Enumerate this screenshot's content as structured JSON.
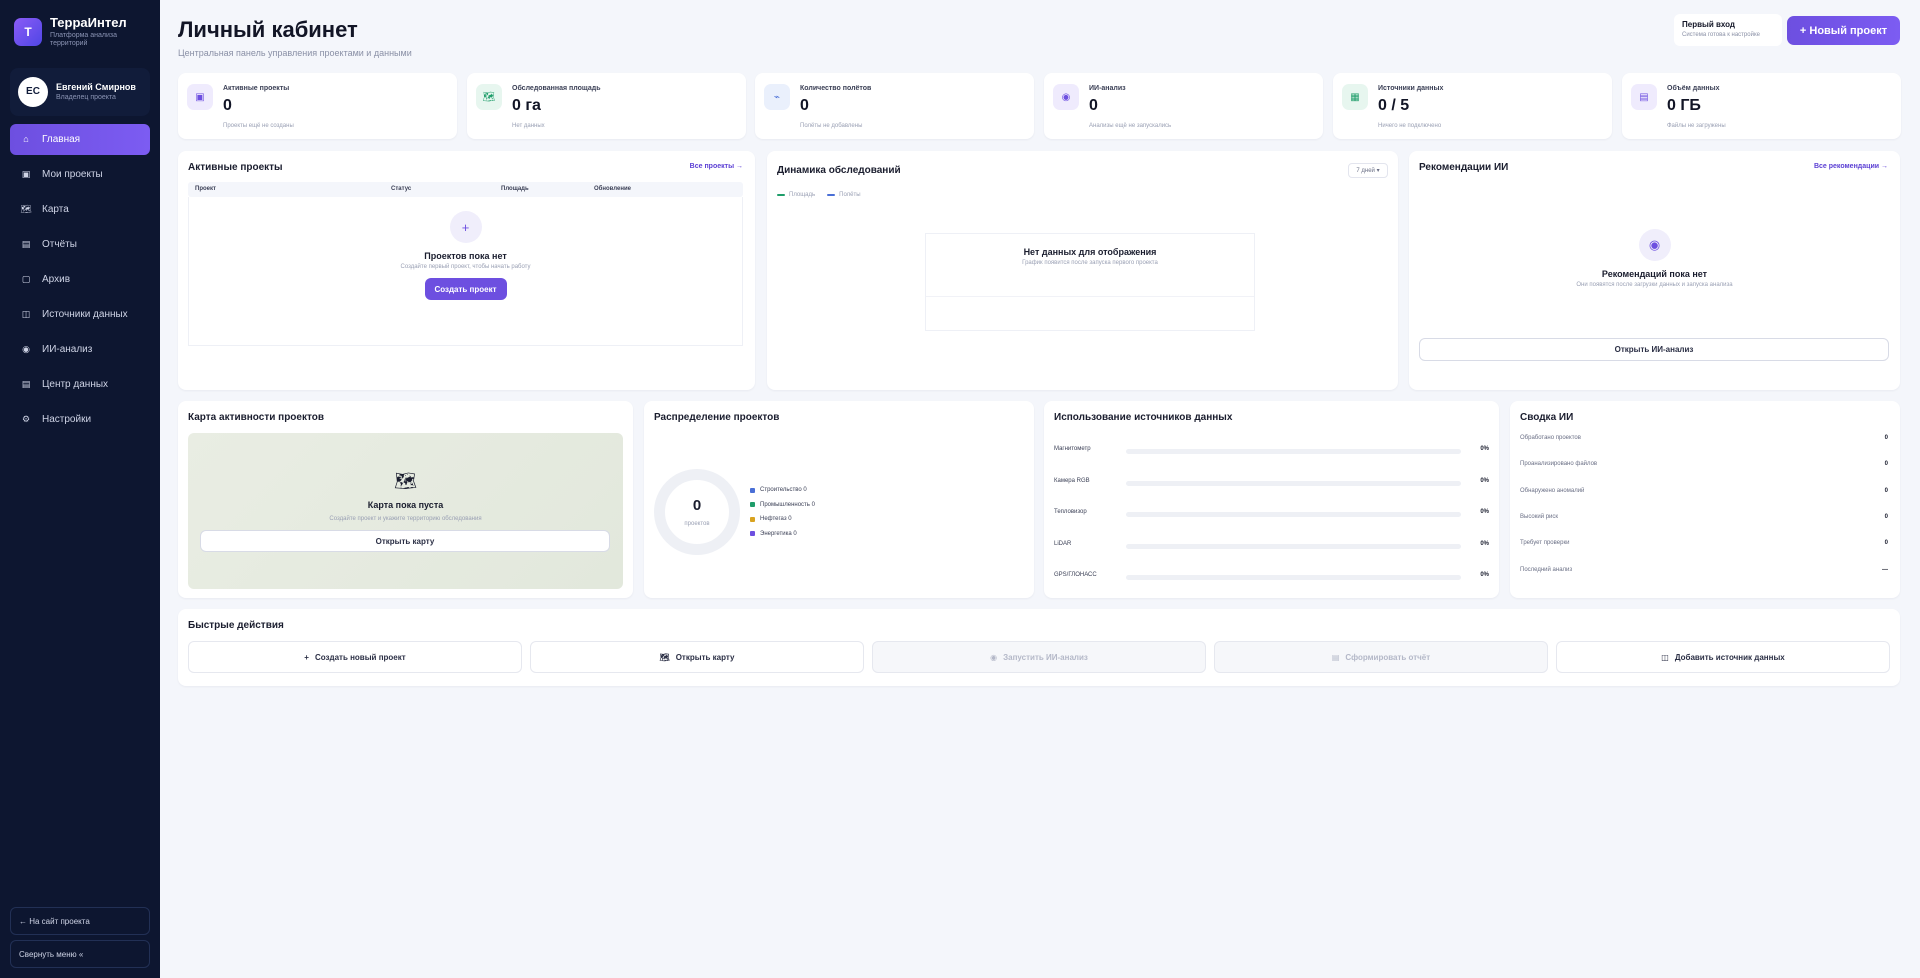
{
  "brand": {
    "name": "ТерраИнтел",
    "subtitle": "Платформа анализа территорий",
    "logo_letter": "Т"
  },
  "user": {
    "initials": "ЕС",
    "name": "Евгений Смирнов",
    "role": "Владелец проекта"
  },
  "sidebar": {
    "items": [
      {
        "label": "Главная",
        "icon": "home-icon",
        "glyph": "⌂",
        "active": true
      },
      {
        "label": "Мои проекты",
        "icon": "projects-icon",
        "glyph": "▣"
      },
      {
        "label": "Карта",
        "icon": "map-icon",
        "glyph": "🗺"
      },
      {
        "label": "Отчёты",
        "icon": "reports-icon",
        "glyph": "▤"
      },
      {
        "label": "Архив",
        "icon": "archive-icon",
        "glyph": "▢"
      },
      {
        "label": "Источники данных",
        "icon": "data-sources-icon",
        "glyph": "◫"
      },
      {
        "label": "ИИ-анализ",
        "icon": "ai-icon",
        "glyph": "◉"
      },
      {
        "label": "Центр данных",
        "icon": "data-center-icon",
        "glyph": "▤"
      },
      {
        "label": "Настройки",
        "icon": "gear-icon",
        "glyph": "⚙"
      }
    ],
    "back_link": "← На сайт проекта",
    "collapse": "Свернуть меню «"
  },
  "header": {
    "title": "Личный кабинет",
    "subtitle": "Центральная панель управления проектами и данными",
    "first_login_title": "Первый вход",
    "first_login_sub": "Система готова к настройке",
    "new_project": "+ Новый проект"
  },
  "stats": [
    {
      "label": "Активные проекты",
      "value": "0",
      "sub": "Проекты ещё не созданы",
      "icon": "projects-icon",
      "glyph": "▣",
      "color": "#6d4fe0",
      "bg": "#efebfd"
    },
    {
      "label": "Обследованная площадь",
      "value": "0 га",
      "sub": "Нет данных",
      "icon": "map-icon",
      "glyph": "🗺",
      "color": "#1f9d6a",
      "bg": "#e7f6ef"
    },
    {
      "label": "Количество полётов",
      "value": "0",
      "sub": "Полёты не добавлены",
      "icon": "flight-icon",
      "glyph": "⌁",
      "color": "#4a6fd6",
      "bg": "#eaf0fc"
    },
    {
      "label": "ИИ-анализ",
      "value": "0",
      "sub": "Анализы ещё не запускались",
      "icon": "ai-icon",
      "glyph": "◉",
      "color": "#6d4fe0",
      "bg": "#efebfd"
    },
    {
      "label": "Источники данных",
      "value": "0 / 5",
      "sub": "Ничего не подключено",
      "icon": "data-sources-icon",
      "glyph": "▦",
      "color": "#1f9d6a",
      "bg": "#e7f6ef"
    },
    {
      "label": "Объём данных",
      "value": "0 ГБ",
      "sub": "Файлы не загружены",
      "icon": "storage-icon",
      "glyph": "▤",
      "color": "#6d4fe0",
      "bg": "#efebfd"
    }
  ],
  "active_projects": {
    "title": "Активные проекты",
    "link": "Все проекты →",
    "columns": [
      "Проект",
      "Статус",
      "Площадь",
      "Обновление"
    ],
    "empty_title": "Проектов пока нет",
    "empty_sub": "Создайте первый проект, чтобы начать работу",
    "button": "Создать проект"
  },
  "dynamics": {
    "title": "Динамика обследований",
    "period": "7 дней ▾",
    "legend": [
      {
        "name": "Площадь",
        "color": "#1f9d6a"
      },
      {
        "name": "Полёты",
        "color": "#4a6fd6"
      }
    ],
    "empty_title": "Нет данных для отображения",
    "empty_sub": "График появится после запуска первого проекта"
  },
  "recommendations": {
    "title": "Рекомендации ИИ",
    "link": "Все рекомендации →",
    "empty_title": "Рекомендаций пока нет",
    "empty_sub": "Они появятся после загрузки данных и запуска анализа",
    "button": "Открыть ИИ-анализ"
  },
  "activity_map": {
    "title": "Карта активности проектов",
    "empty_title": "Карта пока пуста",
    "empty_sub": "Создайте проект и укажите территорию обследования",
    "button": "Открыть карту"
  },
  "distribution": {
    "title": "Распределение проектов",
    "total": "0",
    "total_label": "проектов",
    "legend": [
      {
        "label": "Строительство 0",
        "color": "#4a6fd6"
      },
      {
        "label": "Промышленность 0",
        "color": "#1f9d6a"
      },
      {
        "label": "Нефтегаз 0",
        "color": "#d9a320"
      },
      {
        "label": "Энергетика 0",
        "color": "#6d4fe0"
      }
    ]
  },
  "sources_usage": {
    "title": "Использование источников данных",
    "rows": [
      {
        "label": "Магнитометр",
        "pct": "0%",
        "value": 0
      },
      {
        "label": "Камера RGB",
        "pct": "0%",
        "value": 0
      },
      {
        "label": "Тепловизор",
        "pct": "0%",
        "value": 0
      },
      {
        "label": "LiDAR",
        "pct": "0%",
        "value": 0
      },
      {
        "label": "GPS/ГЛОНАСС",
        "pct": "0%",
        "value": 0
      }
    ]
  },
  "ai_summary": {
    "title": "Сводка ИИ",
    "rows": [
      {
        "label": "Обработано проектов",
        "value": "0"
      },
      {
        "label": "Проанализировано файлов",
        "value": "0"
      },
      {
        "label": "Обнаружено аномалий",
        "value": "0"
      },
      {
        "label": "Высокий риск",
        "value": "0"
      },
      {
        "label": "Требует проверки",
        "value": "0"
      },
      {
        "label": "Последний анализ",
        "value": "—"
      }
    ]
  },
  "quick_actions": {
    "title": "Быстрые действия",
    "items": [
      {
        "label": "Создать новый проект",
        "glyph": "+",
        "icon": "plus-icon",
        "disabled": false
      },
      {
        "label": "Открыть карту",
        "glyph": "🗺",
        "icon": "map-icon",
        "disabled": false
      },
      {
        "label": "Запустить ИИ-анализ",
        "glyph": "◉",
        "icon": "ai-icon",
        "disabled": true
      },
      {
        "label": "Сформировать отчёт",
        "glyph": "▤",
        "icon": "report-icon",
        "disabled": true
      },
      {
        "label": "Добавить источник данных",
        "glyph": "◫",
        "icon": "data-sources-icon",
        "disabled": false
      }
    ]
  }
}
